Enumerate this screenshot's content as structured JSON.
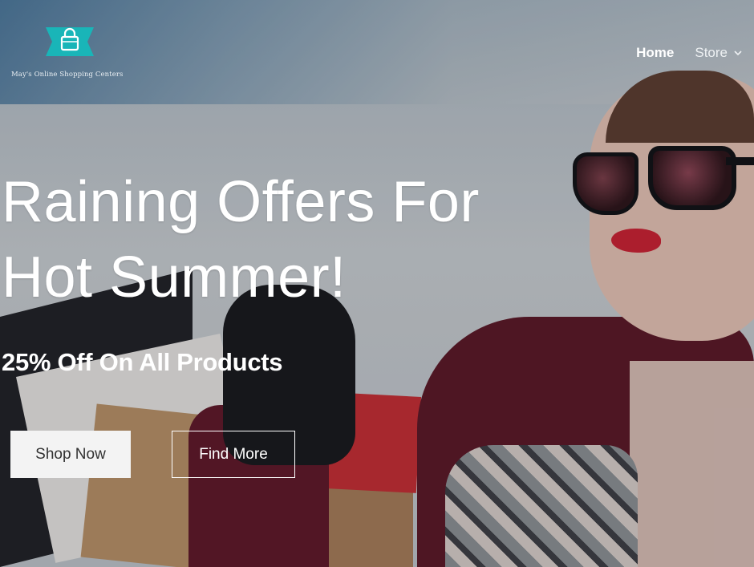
{
  "header": {
    "logo_text": "May's Online Shopping Centers",
    "nav": [
      {
        "label": "Home"
      },
      {
        "label": "Store"
      }
    ]
  },
  "hero": {
    "headline_line1": "Raining Offers For",
    "headline_line2": "Hot Summer!",
    "subheadline": "25% Off On All Products",
    "primary_button": "Shop Now",
    "secondary_button": "Find More"
  },
  "colors": {
    "logo_teal": "#19b5b8",
    "button_light": "#f3f3f3",
    "text_white": "#ffffff"
  },
  "icons": {
    "logo": "shopping-bag-icon",
    "store_dropdown": "chevron-down-icon"
  }
}
